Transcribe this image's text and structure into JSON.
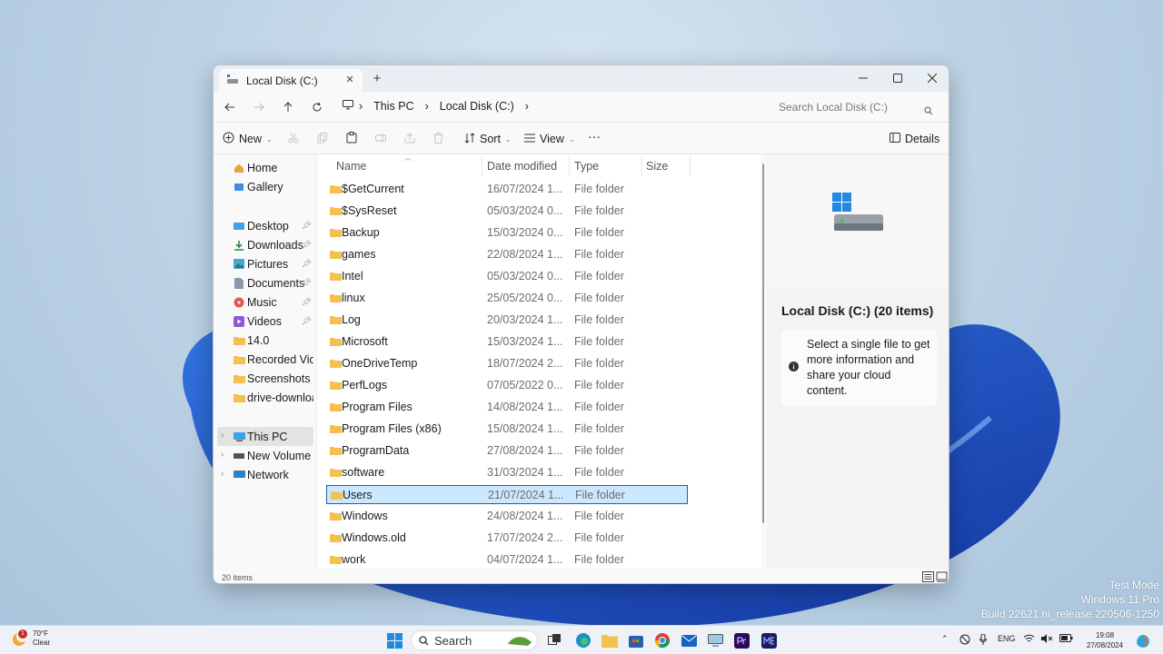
{
  "window": {
    "tab_title": "Local Disk (C:)",
    "new_tab": "+"
  },
  "address": {
    "crumbs": [
      "This PC",
      "Local Disk (C:)"
    ],
    "search_placeholder": "Search Local Disk (C:)"
  },
  "toolbar": {
    "new_label": "New",
    "sort_label": "Sort",
    "view_label": "View",
    "more_label": "···",
    "details_label": "Details"
  },
  "nav": {
    "items": [
      "Home",
      "Gallery",
      "Desktop",
      "Downloads",
      "Pictures",
      "Documents",
      "Music",
      "Videos",
      "14.0",
      "Recorded Videos",
      "Screenshots",
      "drive-download",
      "This PC",
      "New Volume (",
      "Network"
    ]
  },
  "columns": {
    "name": "Name",
    "date": "Date modified",
    "type": "Type",
    "size": "Size"
  },
  "files": [
    {
      "name": "$GetCurrent",
      "date": "16/07/2024 1...",
      "type": "File folder"
    },
    {
      "name": "$SysReset",
      "date": "05/03/2024 0...",
      "type": "File folder"
    },
    {
      "name": "Backup",
      "date": "15/03/2024 0...",
      "type": "File folder"
    },
    {
      "name": "games",
      "date": "22/08/2024 1...",
      "type": "File folder"
    },
    {
      "name": "Intel",
      "date": "05/03/2024 0...",
      "type": "File folder"
    },
    {
      "name": "linux",
      "date": "25/05/2024 0...",
      "type": "File folder"
    },
    {
      "name": "Log",
      "date": "20/03/2024 1...",
      "type": "File folder"
    },
    {
      "name": "Microsoft",
      "date": "15/03/2024 1...",
      "type": "File folder"
    },
    {
      "name": "OneDriveTemp",
      "date": "18/07/2024 2...",
      "type": "File folder"
    },
    {
      "name": "PerfLogs",
      "date": "07/05/2022 0...",
      "type": "File folder"
    },
    {
      "name": "Program Files",
      "date": "14/08/2024 1...",
      "type": "File folder"
    },
    {
      "name": "Program Files (x86)",
      "date": "15/08/2024 1...",
      "type": "File folder"
    },
    {
      "name": "ProgramData",
      "date": "27/08/2024 1...",
      "type": "File folder"
    },
    {
      "name": "software",
      "date": "31/03/2024 1...",
      "type": "File folder"
    },
    {
      "name": "Users",
      "date": "21/07/2024 1...",
      "type": "File folder"
    },
    {
      "name": "Windows",
      "date": "24/08/2024 1...",
      "type": "File folder"
    },
    {
      "name": "Windows.old",
      "date": "17/07/2024 2...",
      "type": "File folder"
    },
    {
      "name": "work",
      "date": "04/07/2024 1...",
      "type": "File folder"
    }
  ],
  "selected_file": "Users",
  "details": {
    "title": "Local Disk (C:) (20 items)",
    "message": "Select a single file to get more information and share your cloud content."
  },
  "status": {
    "count": "20 items"
  },
  "watermark": {
    "line1": "Test Mode",
    "line2": "Windows 11 Pro",
    "line3": "Build 22621.ni_release.220506-1250"
  },
  "taskbar": {
    "weather_temp": "70°F",
    "weather_cond": "Clear",
    "weather_badge": "1",
    "search_label": "Search",
    "lang": "ENG",
    "time": "19:08",
    "date": "27/08/2024"
  },
  "colors": {
    "accent": "#1f5fa8",
    "selection": "#cce8ff",
    "folder": "#f2c14e"
  }
}
